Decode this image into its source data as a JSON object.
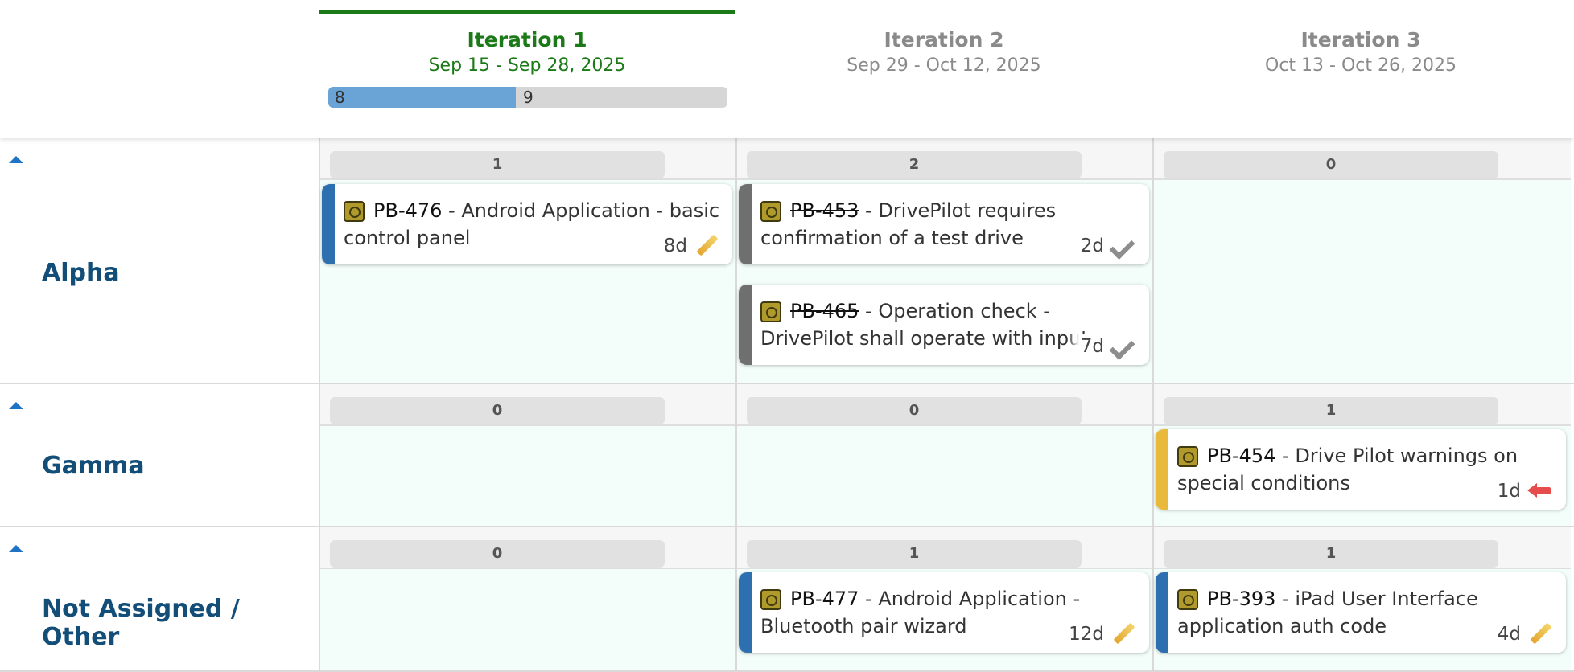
{
  "iterations": [
    {
      "title": "Iteration 1",
      "dates": "Sep 15 - Sep 28, 2025",
      "progress_done": "8",
      "progress_remaining": "9",
      "progress_fraction": 0.47,
      "accent_color": "#1b7a17"
    },
    {
      "title": "Iteration 2",
      "dates": "Sep 29 - Oct 12, 2025"
    },
    {
      "title": "Iteration 3",
      "dates": "Oct 13 - Oct 26, 2025"
    }
  ],
  "lanes": [
    {
      "name": "Alpha",
      "counts": [
        "1",
        "2",
        "0"
      ],
      "cards": {
        "i1": [
          {
            "key": "PB-476",
            "title_line1": " - Android Application - basic",
            "title_line2": "control panel",
            "estimate": "8d",
            "status_icon": "pencil-icon",
            "stripe_color": "#2e6fb0"
          }
        ],
        "i2": [
          {
            "key": "PB-453",
            "title_line1": " - DrivePilot requires",
            "title_line2": "confirmation of a test drive",
            "estimate": "2d",
            "status_icon": "check-icon",
            "stripe_color": "#6f6f6f",
            "key_style": "strikethrough"
          },
          {
            "key": "PB-465",
            "title_line1": " - Operation check -",
            "title_line2": "DrivePilot shall operate with input",
            "estimate": "7d",
            "status_icon": "check-icon",
            "stripe_color": "#6f6f6f",
            "key_style": "strikethrough-green"
          }
        ]
      }
    },
    {
      "name": "Gamma",
      "counts": [
        "0",
        "0",
        "1"
      ],
      "cards": {
        "i3": [
          {
            "key": "PB-454",
            "title_line1": " - Drive Pilot warnings on",
            "title_line2": "special conditions",
            "estimate": "1d",
            "status_icon": "arrow-left-icon",
            "stripe_color": "#e8b93a"
          }
        ]
      }
    },
    {
      "name": "Not Assigned / Other",
      "counts": [
        "0",
        "1",
        "1"
      ],
      "cards": {
        "i2": [
          {
            "key": "PB-477",
            "title_line1": " - Android Application -",
            "title_line2": "Bluetooth pair wizard",
            "estimate": "12d",
            "status_icon": "pencil-icon",
            "stripe_color": "#2e6fb0"
          }
        ],
        "i3": [
          {
            "key": "PB-393",
            "title_line1": " - iPad User Interface",
            "title_line2": "application auth code",
            "estimate": "4d",
            "status_icon": "pencil-icon",
            "stripe_color": "#2e6fb0"
          }
        ]
      }
    }
  ]
}
